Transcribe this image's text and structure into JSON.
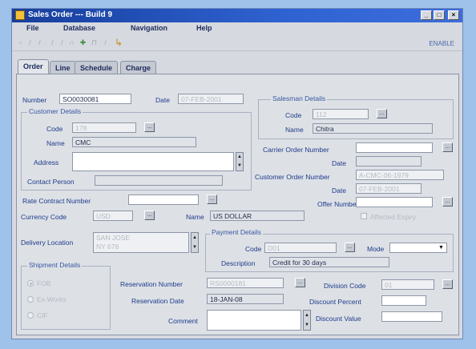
{
  "window": {
    "title": "Sales Order --- Build 9",
    "min": "_",
    "max": "□",
    "close": "×"
  },
  "menus": [
    "File",
    "Database",
    "Navigation",
    "Help"
  ],
  "toolbar": {
    "right_label": "ENABLE"
  },
  "tabs": [
    "Order",
    "Line",
    "Schedule",
    "Charge"
  ],
  "order": {
    "number_label": "Number",
    "number_value": "SO0030081",
    "date_label": "Date",
    "date_value": "07-FEB-2001"
  },
  "customer": {
    "group_label": "Customer Details",
    "code_label": "Code",
    "code_value": "178",
    "name_label": "Name",
    "name_value": "CMC",
    "address_label": "Address",
    "address_value": "",
    "contact_label": "Contact Person",
    "contact_value": ""
  },
  "salesman": {
    "group_label": "Salesman Details",
    "code_label": "Code",
    "code_value": "112",
    "name_label": "Name",
    "name_value": "Chitra"
  },
  "carrier": {
    "order_number_label": "Carrier Order Number",
    "order_number_value": "",
    "date_label": "Date",
    "date_value": ""
  },
  "customer_order": {
    "number_label": "Customer Order Number",
    "number_value": "A-CMC-06-1979",
    "date_label": "Date",
    "date_value": "07-FEB-2001"
  },
  "offer": {
    "label": "Offer Number",
    "value": ""
  },
  "rate_contract": {
    "label": "Rate Contract Number",
    "value": ""
  },
  "currency": {
    "code_label": "Currency Code",
    "code_value": "USD",
    "name_label": "Name",
    "name_value": "US DOLLAR",
    "affect_label": "Affected Expiry"
  },
  "delivery": {
    "label": "Delivery Location",
    "value_line1": "SAN JOSE",
    "value_line2": "NY 678"
  },
  "payment": {
    "group_label": "Payment Details",
    "code_label": "Code",
    "code_value": "D01",
    "mode_label": "Mode",
    "mode_value": "",
    "description_label": "Description",
    "description_value": "Credit for 30 days"
  },
  "shipment": {
    "group_label": "Shipment Details",
    "options": [
      "FOB",
      "Ex-Works",
      "CIF"
    ]
  },
  "reservation": {
    "number_label": "Reservation Number",
    "number_value": "RS0000181",
    "date_label": "Reservation Date",
    "date_value": "18-JAN-08"
  },
  "comment": {
    "label": "Comment",
    "value": ""
  },
  "discount": {
    "division_label": "Division Code",
    "division_value": "01",
    "percent_label": "Discount Percent",
    "percent_value": "",
    "value_label": "Discount Value",
    "value_value": ""
  }
}
